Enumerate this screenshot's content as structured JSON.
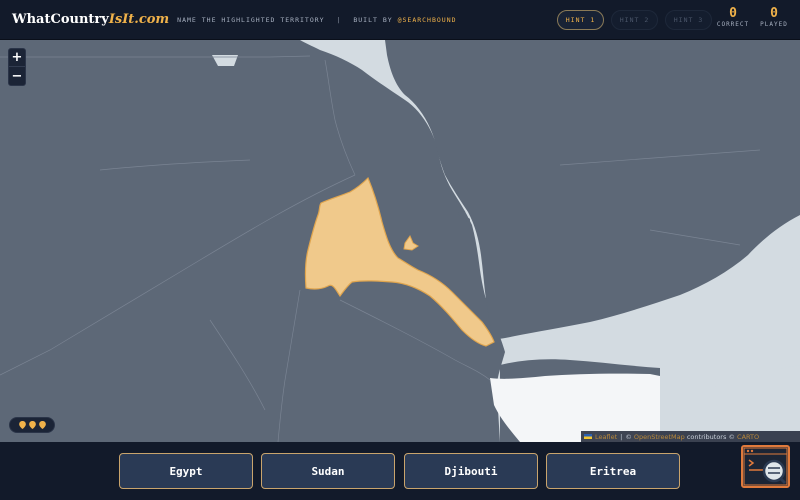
{
  "header": {
    "logo_main": "WhatCountry",
    "logo_accent": "IsIt.com",
    "tagline_left": "NAME THE HIGHLIGHTED TERRITORY",
    "tagline_separator": "|",
    "tagline_built_by": "BUILT BY",
    "tagline_handle": "@SEARCHBOUND",
    "hints": [
      {
        "label": "HINT 1",
        "active": true
      },
      {
        "label": "HINT 2",
        "active": false
      },
      {
        "label": "HINT 3",
        "active": false
      }
    ],
    "stats": {
      "correct": {
        "value": "0",
        "label": "CORRECT"
      },
      "played": {
        "value": "0",
        "label": "PLAYED"
      }
    }
  },
  "map": {
    "zoom_in": "+",
    "zoom_out": "−",
    "lives_remaining": 3,
    "attribution": {
      "provider": "Leaflet",
      "separator": "|",
      "copyright": "©",
      "osm": "OpenStreetMap",
      "contributors": "contributors",
      "copyright2": "©",
      "carto": "CARTO"
    },
    "colors": {
      "land": "#5d6877",
      "sea": "#d3dbe1",
      "highlight": "#f0c98b",
      "highlight_border": "#e0a54e"
    }
  },
  "answers": [
    {
      "label": "Egypt"
    },
    {
      "label": "Sudan"
    },
    {
      "label": "Djibouti"
    },
    {
      "label": "Eritrea"
    }
  ],
  "theme": {
    "accent": "#f0b24a",
    "background": "#121a2a",
    "button_bg": "#2a3a55",
    "button_border": "#c9a46c"
  }
}
